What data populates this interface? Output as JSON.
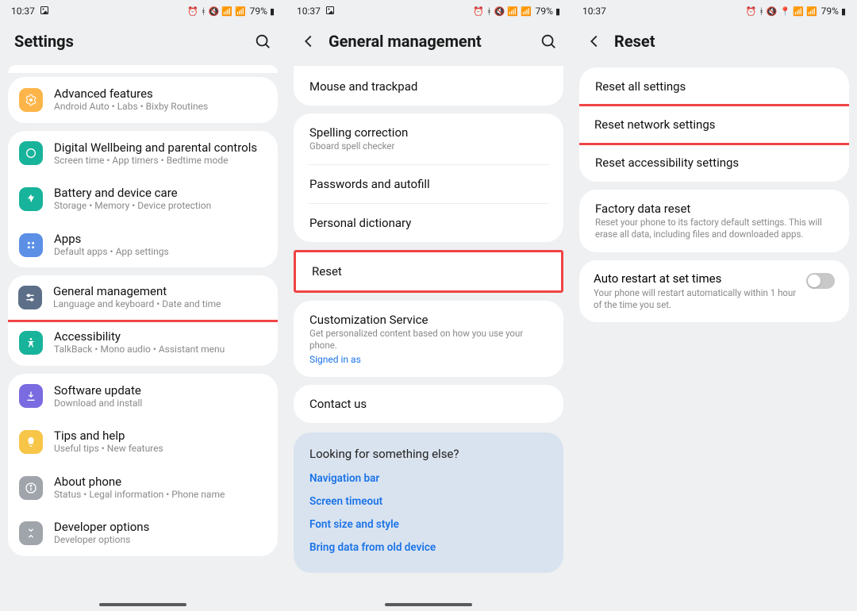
{
  "status": {
    "time": "10:37",
    "battery_pct": "79%",
    "icons_extra_location": true
  },
  "screen1": {
    "title": "Settings",
    "groups": [
      {
        "id": "adv",
        "items": [
          {
            "icon": "ic-orange",
            "iconName": "gear-icon",
            "label": "Advanced features",
            "sub": "Android Auto  •  Labs  •  Bixby Routines"
          }
        ]
      },
      {
        "id": "care",
        "items": [
          {
            "icon": "ic-teal",
            "iconName": "wellbeing-icon",
            "label": "Digital Wellbeing and parental controls",
            "sub": "Screen time  •  App timers  •  Bedtime mode"
          },
          {
            "icon": "ic-teal2",
            "iconName": "battery-icon",
            "label": "Battery and device care",
            "sub": "Storage  •  Memory  •  Device protection"
          },
          {
            "icon": "ic-blue",
            "iconName": "apps-icon",
            "label": "Apps",
            "sub": "Default apps  •  App settings"
          }
        ]
      },
      {
        "id": "gen",
        "items": [
          {
            "icon": "ic-slate",
            "iconName": "sliders-icon",
            "label": "General management",
            "sub": "Language and keyboard  •  Date and time",
            "highlight": true
          },
          {
            "icon": "ic-green",
            "iconName": "accessibility-icon",
            "label": "Accessibility",
            "sub": "TalkBack  •  Mono audio  •  Assistant menu"
          }
        ]
      },
      {
        "id": "about",
        "items": [
          {
            "icon": "ic-purple",
            "iconName": "update-icon",
            "label": "Software update",
            "sub": "Download and install"
          },
          {
            "icon": "ic-yellow",
            "iconName": "tips-icon",
            "label": "Tips and help",
            "sub": "Useful tips  •  New features"
          },
          {
            "icon": "ic-grey",
            "iconName": "info-icon",
            "label": "About phone",
            "sub": "Status  •  Legal information  •  Phone name"
          },
          {
            "icon": "ic-grey",
            "iconName": "dev-icon",
            "label": "Developer options",
            "sub": "Developer options"
          }
        ]
      }
    ]
  },
  "screen2": {
    "title": "General management",
    "group1": [
      {
        "label": "Mouse and trackpad"
      }
    ],
    "group2": [
      {
        "label": "Spelling correction",
        "sub": "Gboard spell checker"
      },
      {
        "label": "Passwords and autofill"
      },
      {
        "label": "Personal dictionary"
      }
    ],
    "reset": {
      "label": "Reset"
    },
    "custom": {
      "label": "Customization Service",
      "sub": "Get personalized content based on how you use your phone.",
      "link": "Signed in as"
    },
    "contact": {
      "label": "Contact us"
    },
    "looking": {
      "q": "Looking for something else?",
      "links": [
        "Navigation bar",
        "Screen timeout",
        "Font size and style",
        "Bring data from old device"
      ]
    }
  },
  "screen3": {
    "title": "Reset",
    "group1": [
      {
        "label": "Reset all settings"
      },
      {
        "label": "Reset network settings",
        "highlight": true
      },
      {
        "label": "Reset accessibility settings"
      }
    ],
    "factory": {
      "label": "Factory data reset",
      "sub": "Reset your phone to its factory default settings. This will erase all data, including files and downloaded apps."
    },
    "auto": {
      "label": "Auto restart at set times",
      "sub": "Your phone will restart automatically within 1 hour of the time you set."
    }
  }
}
